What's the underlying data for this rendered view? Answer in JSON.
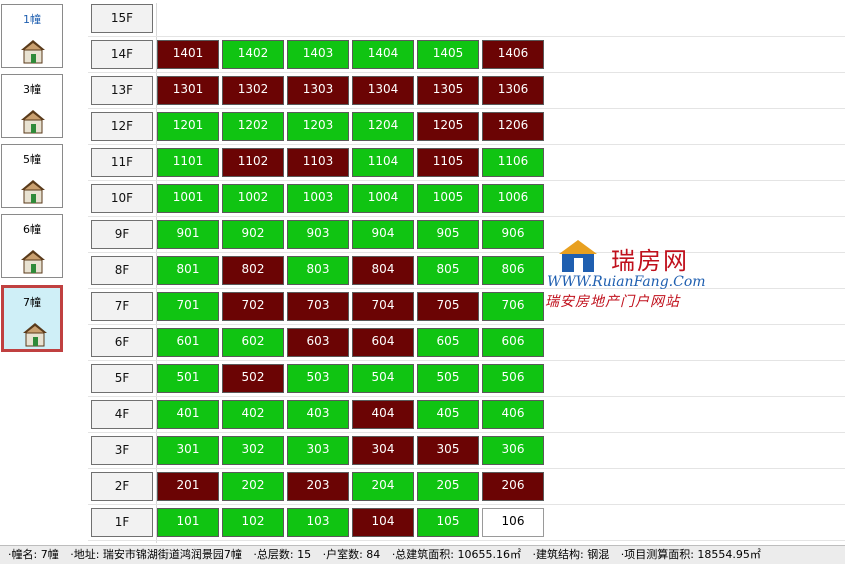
{
  "sidebar": {
    "buildings": [
      {
        "label": "1幢",
        "selected": false,
        "icon": "house-icon"
      },
      {
        "label": "3幢",
        "selected": false,
        "icon": "house-icon"
      },
      {
        "label": "5幢",
        "selected": false,
        "icon": "house-icon"
      },
      {
        "label": "6幢",
        "selected": false,
        "icon": "house-icon"
      },
      {
        "label": "7幢",
        "selected": true,
        "icon": "house-icon"
      }
    ]
  },
  "floors": [
    {
      "label": "15F",
      "units": []
    },
    {
      "label": "14F",
      "units": [
        {
          "no": "1401",
          "status": "sold"
        },
        {
          "no": "1402",
          "status": "available"
        },
        {
          "no": "1403",
          "status": "available"
        },
        {
          "no": "1404",
          "status": "available"
        },
        {
          "no": "1405",
          "status": "available"
        },
        {
          "no": "1406",
          "status": "sold"
        }
      ]
    },
    {
      "label": "13F",
      "units": [
        {
          "no": "1301",
          "status": "sold"
        },
        {
          "no": "1302",
          "status": "sold"
        },
        {
          "no": "1303",
          "status": "sold"
        },
        {
          "no": "1304",
          "status": "sold"
        },
        {
          "no": "1305",
          "status": "sold"
        },
        {
          "no": "1306",
          "status": "sold"
        }
      ]
    },
    {
      "label": "12F",
      "units": [
        {
          "no": "1201",
          "status": "available"
        },
        {
          "no": "1202",
          "status": "available"
        },
        {
          "no": "1203",
          "status": "available"
        },
        {
          "no": "1204",
          "status": "available"
        },
        {
          "no": "1205",
          "status": "sold"
        },
        {
          "no": "1206",
          "status": "sold"
        }
      ]
    },
    {
      "label": "11F",
      "units": [
        {
          "no": "1101",
          "status": "available"
        },
        {
          "no": "1102",
          "status": "sold"
        },
        {
          "no": "1103",
          "status": "sold"
        },
        {
          "no": "1104",
          "status": "available"
        },
        {
          "no": "1105",
          "status": "sold"
        },
        {
          "no": "1106",
          "status": "available"
        }
      ]
    },
    {
      "label": "10F",
      "units": [
        {
          "no": "1001",
          "status": "available"
        },
        {
          "no": "1002",
          "status": "available"
        },
        {
          "no": "1003",
          "status": "available"
        },
        {
          "no": "1004",
          "status": "available"
        },
        {
          "no": "1005",
          "status": "available"
        },
        {
          "no": "1006",
          "status": "available"
        }
      ]
    },
    {
      "label": "9F",
      "units": [
        {
          "no": "901",
          "status": "available"
        },
        {
          "no": "902",
          "status": "available"
        },
        {
          "no": "903",
          "status": "available"
        },
        {
          "no": "904",
          "status": "available"
        },
        {
          "no": "905",
          "status": "available"
        },
        {
          "no": "906",
          "status": "available"
        }
      ]
    },
    {
      "label": "8F",
      "units": [
        {
          "no": "801",
          "status": "available"
        },
        {
          "no": "802",
          "status": "sold"
        },
        {
          "no": "803",
          "status": "available"
        },
        {
          "no": "804",
          "status": "sold"
        },
        {
          "no": "805",
          "status": "available"
        },
        {
          "no": "806",
          "status": "available"
        }
      ]
    },
    {
      "label": "7F",
      "units": [
        {
          "no": "701",
          "status": "available"
        },
        {
          "no": "702",
          "status": "sold"
        },
        {
          "no": "703",
          "status": "sold"
        },
        {
          "no": "704",
          "status": "sold"
        },
        {
          "no": "705",
          "status": "sold"
        },
        {
          "no": "706",
          "status": "available"
        }
      ]
    },
    {
      "label": "6F",
      "units": [
        {
          "no": "601",
          "status": "available"
        },
        {
          "no": "602",
          "status": "available"
        },
        {
          "no": "603",
          "status": "sold"
        },
        {
          "no": "604",
          "status": "sold"
        },
        {
          "no": "605",
          "status": "available"
        },
        {
          "no": "606",
          "status": "available"
        }
      ]
    },
    {
      "label": "5F",
      "units": [
        {
          "no": "501",
          "status": "available"
        },
        {
          "no": "502",
          "status": "sold"
        },
        {
          "no": "503",
          "status": "available"
        },
        {
          "no": "504",
          "status": "available"
        },
        {
          "no": "505",
          "status": "available"
        },
        {
          "no": "506",
          "status": "available"
        }
      ]
    },
    {
      "label": "4F",
      "units": [
        {
          "no": "401",
          "status": "available"
        },
        {
          "no": "402",
          "status": "available"
        },
        {
          "no": "403",
          "status": "available"
        },
        {
          "no": "404",
          "status": "sold"
        },
        {
          "no": "405",
          "status": "available"
        },
        {
          "no": "406",
          "status": "available"
        }
      ]
    },
    {
      "label": "3F",
      "units": [
        {
          "no": "301",
          "status": "available"
        },
        {
          "no": "302",
          "status": "available"
        },
        {
          "no": "303",
          "status": "available"
        },
        {
          "no": "304",
          "status": "sold"
        },
        {
          "no": "305",
          "status": "sold"
        },
        {
          "no": "306",
          "status": "available"
        }
      ]
    },
    {
      "label": "2F",
      "units": [
        {
          "no": "201",
          "status": "sold"
        },
        {
          "no": "202",
          "status": "available"
        },
        {
          "no": "203",
          "status": "sold"
        },
        {
          "no": "204",
          "status": "available"
        },
        {
          "no": "205",
          "status": "available"
        },
        {
          "no": "206",
          "status": "sold"
        }
      ]
    },
    {
      "label": "1F",
      "units": [
        {
          "no": "101",
          "status": "available"
        },
        {
          "no": "102",
          "status": "available"
        },
        {
          "no": "103",
          "status": "available"
        },
        {
          "no": "104",
          "status": "sold"
        },
        {
          "no": "105",
          "status": "available"
        },
        {
          "no": "106",
          "status": "other"
        }
      ]
    }
  ],
  "colors": {
    "available": "#10c412",
    "sold": "#6b0404",
    "other": "#ffffff"
  },
  "watermark": {
    "name": "瑞房网",
    "url": "WWW.RuianFang.Com",
    "slogan": "瑞安房地产门户网站",
    "icon": "house-logo-icon"
  },
  "status_bar": {
    "building": "·幢名: 7幢",
    "address": "·地址: 瑞安市锦湖街道鸿润景园7幢",
    "floors": "·总层数: 15",
    "units": "·户室数: 84",
    "area": "·总建筑面积: 10655.16㎡",
    "structure": "·建筑结构: 钢混",
    "project_area": "·项目测算面积: 18554.95㎡"
  }
}
